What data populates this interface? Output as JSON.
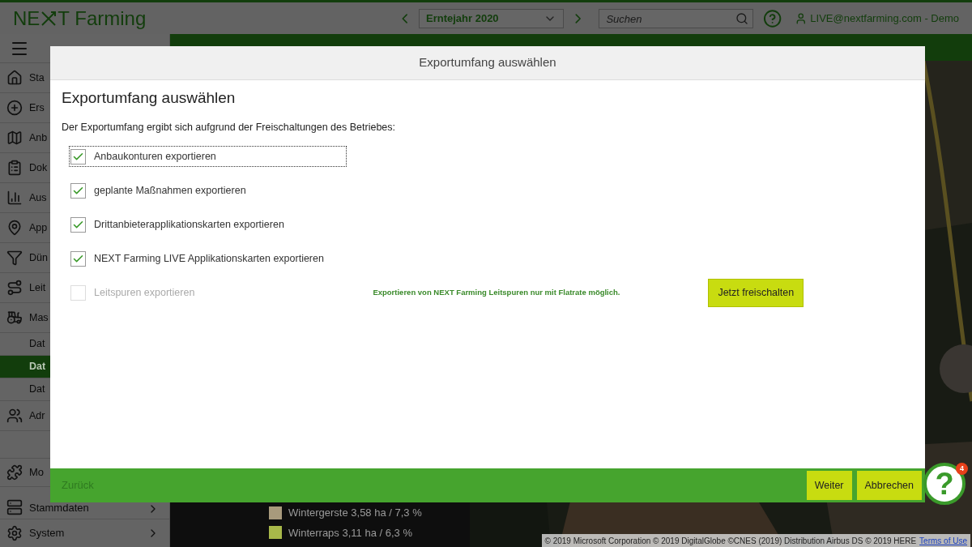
{
  "header": {
    "logo_prefix": "NE",
    "logo_suffix": "T Farming",
    "season": "Erntejahr 2020",
    "search": {
      "placeholder": "Suchen"
    },
    "user": "LIVE@nextfarming.com - Demo"
  },
  "sidebar": {
    "items": [
      {
        "label": "Sta",
        "kind": "main",
        "selected": false
      },
      {
        "label": "Ers",
        "kind": "main",
        "selected": false
      },
      {
        "label": "Anb",
        "kind": "main",
        "selected": false
      },
      {
        "label": "Dok",
        "kind": "main",
        "selected": false
      },
      {
        "label": "Aus",
        "kind": "main",
        "selected": false
      },
      {
        "label": "App",
        "kind": "main",
        "selected": false
      },
      {
        "label": "Dün",
        "kind": "main",
        "selected": false
      },
      {
        "label": "Leit",
        "kind": "main",
        "selected": false
      },
      {
        "label": "Mas",
        "kind": "main",
        "selected": false
      },
      {
        "label": "Dat",
        "kind": "sub",
        "selected": false
      },
      {
        "label": "Dat",
        "kind": "sub",
        "selected": true
      },
      {
        "label": "Dat",
        "kind": "sub",
        "selected": false
      },
      {
        "label": "Adr",
        "kind": "main",
        "selected": false
      }
    ],
    "bottom_items": [
      {
        "label": "Mo",
        "kind": "main"
      },
      {
        "label": "Stammdaten",
        "kind": "group"
      },
      {
        "label": "System",
        "kind": "group"
      }
    ]
  },
  "main": {
    "legend": [
      {
        "label": "Wintergerste 3,58 ha / 7,3 %",
        "color": "#a89a7c"
      },
      {
        "label": "Winterraps 3,11 ha / 6,3 %",
        "color": "#a8b84a"
      }
    ],
    "copyright": "© 2019 Microsoft Corporation © 2019 DigitalGlobe ©CNES (2019) Distribution Airbus DS © 2019 HERE",
    "terms_link": "Terms of Use"
  },
  "dialog": {
    "title": "Exportumfang auswählen",
    "heading": "Exportumfang auswählen",
    "intro": "Der Exportumfang ergibt sich aufgrund der Freischaltungen des Betriebes:",
    "options": [
      {
        "label": "Anbaukonturen exportieren",
        "checked": true,
        "disabled": false,
        "focused": true
      },
      {
        "label": "geplante Maßnahmen exportieren",
        "checked": true,
        "disabled": false,
        "focused": false
      },
      {
        "label": "Drittanbieterapplikationskarten exportieren",
        "checked": true,
        "disabled": false,
        "focused": false
      },
      {
        "label": "NEXT Farming LIVE Applikationskarten exportieren",
        "checked": true,
        "disabled": false,
        "focused": false
      },
      {
        "label": "Leitspuren exportieren",
        "checked": false,
        "disabled": true,
        "focused": false,
        "notice": "Exportieren von NEXT Farming Leitspuren nur mit Flatrate möglich.",
        "unlock_button": "Jetzt freischalten"
      }
    ],
    "back": "Zurück",
    "buttons": [
      "Weiter",
      "Abbrechen"
    ]
  },
  "help": {
    "label": "?",
    "badge": "4"
  }
}
